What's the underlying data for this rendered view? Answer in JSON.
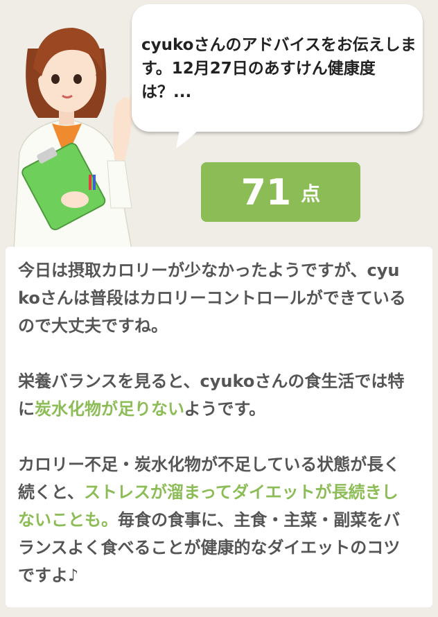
{
  "speech_bubble": {
    "text": "cyukoさんのアドバイスをお伝えします。12月27日のあすけん健康度は？..."
  },
  "score": {
    "value": "71",
    "unit": "点"
  },
  "advice": {
    "p1": "今日は摂取カロリーが少なかったようですが、cyukoさんは普段はカロリーコントロールができているので大丈夫ですね。",
    "p2_before": "栄養バランスを見ると、cyukoさんの食生活では特に",
    "p2_highlight": "炭水化物が足りない",
    "p2_after": "ようです。",
    "p3_before": "カロリー不足・炭水化物が不足している状態が長く続くと、",
    "p3_highlight": "ストレスが溜まってダイエットが長続きしないことも。",
    "p3_after": "毎食の食事に、主食・主菜・副菜をバランスよく食べることが健康的なダイエットのコツですよ♪"
  },
  "colors": {
    "accent": "#8bbc55",
    "background": "#f0ede6",
    "text": "#555555"
  },
  "icons": {
    "advisor": "nurse-with-clipboard-illustration"
  }
}
